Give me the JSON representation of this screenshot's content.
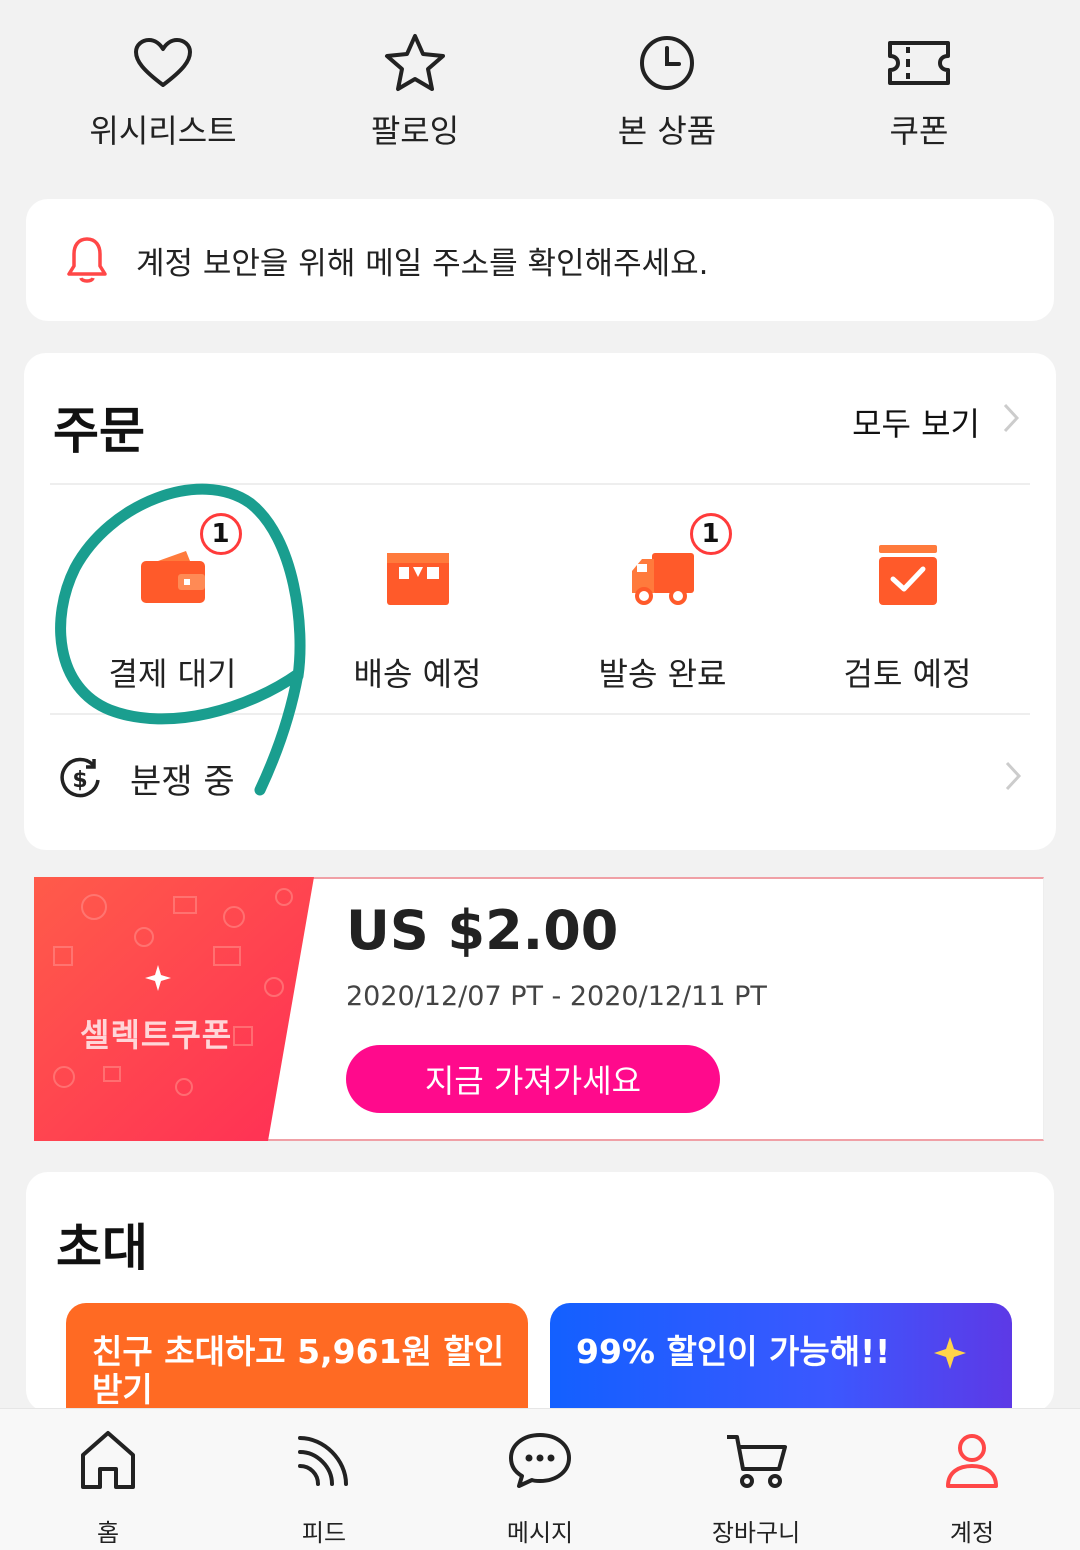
{
  "quick_links": [
    {
      "label": "위시리스트",
      "icon": "heart-icon"
    },
    {
      "label": "팔로잉",
      "icon": "star-icon"
    },
    {
      "label": "본 상품",
      "icon": "clock-icon"
    },
    {
      "label": "쿠폰",
      "icon": "ticket-icon"
    }
  ],
  "notice": {
    "text": "계정 보안을 위해 메일 주소를 확인해주세요.",
    "icon": "bell-icon"
  },
  "orders": {
    "title": "주문",
    "view_all": "모두 보기",
    "statuses": [
      {
        "label": "결제 대기",
        "badge": "1",
        "icon": "wallet-icon"
      },
      {
        "label": "배송 예정",
        "badge": "",
        "icon": "box-icon"
      },
      {
        "label": "발송 완료",
        "badge": "1",
        "icon": "truck-icon"
      },
      {
        "label": "검토 예정",
        "badge": "",
        "icon": "review-check-icon"
      }
    ],
    "dispute": {
      "label": "분쟁 중",
      "icon": "dispute-dollar-icon"
    }
  },
  "coupon": {
    "name": "셀렉트쿠폰",
    "amount": "US $2.00",
    "period": "2020/12/07 PT - 2020/12/11 PT",
    "button": "지금 가져가세요"
  },
  "invite": {
    "title": "초대",
    "promos": [
      {
        "text": "친구 초대하고 5,961원 할인 받기"
      },
      {
        "text": "99% 할인이 가능해!!"
      }
    ]
  },
  "nav": [
    {
      "label": "홈",
      "icon": "home-icon"
    },
    {
      "label": "피드",
      "icon": "feed-icon"
    },
    {
      "label": "메시지",
      "icon": "message-icon"
    },
    {
      "label": "장바구니",
      "icon": "cart-icon"
    },
    {
      "label": "계정",
      "icon": "account-icon",
      "active": true
    }
  ],
  "colors": {
    "accent": "#ff4747",
    "coupon_button": "#ff0a8c",
    "annotation": "#1a9e8f"
  }
}
